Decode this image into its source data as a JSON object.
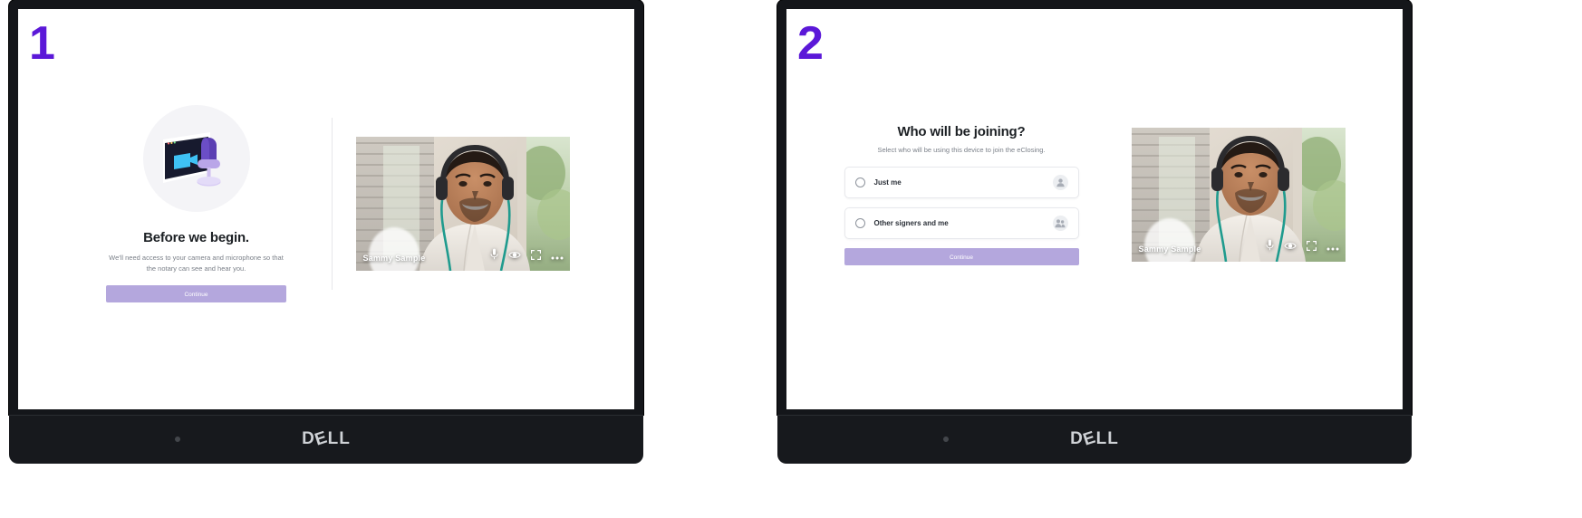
{
  "steps": [
    {
      "number": "1"
    },
    {
      "number": "2"
    }
  ],
  "device": {
    "brand": "DELL"
  },
  "colors": {
    "step_number": "#5b18d8",
    "primary_button": "#b4a7dd",
    "heading_text": "#1c2024",
    "muted_text": "#7b8089"
  },
  "screen1": {
    "illustration": "video-call-microphone-illustration",
    "title": "Before we begin.",
    "subtitle": "We'll need access to your camera and microphone so that the notary can see and hear you.",
    "continue_label": "Continue",
    "video": {
      "participant_name": "Sammy Sample",
      "controls": [
        {
          "name": "microphone-icon",
          "label": "Microphone"
        },
        {
          "name": "eye-icon",
          "label": "View"
        },
        {
          "name": "fullscreen-icon",
          "label": "Fullscreen"
        },
        {
          "name": "more-options-icon",
          "label": "More options"
        }
      ]
    }
  },
  "screen2": {
    "title": "Who will be joining?",
    "subtitle": "Select who will be using this device to join the eClosing.",
    "options": [
      {
        "label": "Just me",
        "icon": "single-person-avatar-icon",
        "selected": false
      },
      {
        "label": "Other signers and me",
        "icon": "multiple-people-avatar-icon",
        "selected": false
      }
    ],
    "continue_label": "Continue",
    "video": {
      "participant_name": "Sammy Sample",
      "controls": [
        {
          "name": "microphone-icon",
          "label": "Microphone"
        },
        {
          "name": "eye-icon",
          "label": "View"
        },
        {
          "name": "fullscreen-icon",
          "label": "Fullscreen"
        },
        {
          "name": "more-options-icon",
          "label": "More options"
        }
      ]
    }
  }
}
